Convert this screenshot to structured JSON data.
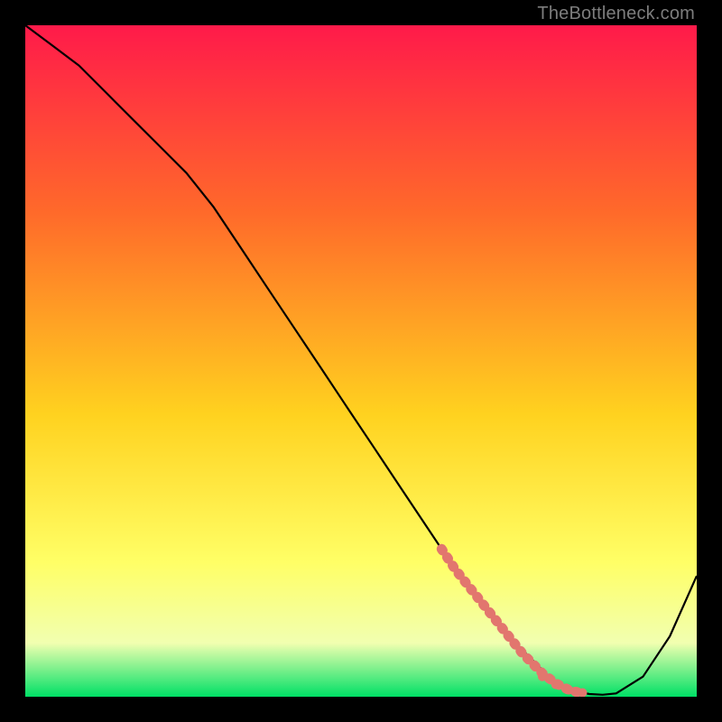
{
  "watermark": "TheBottleneck.com",
  "colors": {
    "black": "#000000",
    "curve": "#000000",
    "dash": "#e2766e",
    "grad_top": "#ff1a4a",
    "grad_mid1": "#ff6a2a",
    "grad_mid2": "#ffd21f",
    "grad_mid3": "#ffff66",
    "grad_mid4": "#f1ffb0",
    "grad_bottom": "#00e066"
  },
  "chart_data": {
    "type": "line",
    "title": "",
    "xlabel": "",
    "ylabel": "",
    "xlim": [
      0,
      100
    ],
    "ylim": [
      0,
      100
    ],
    "series": [
      {
        "name": "bottleneck-curve",
        "x": [
          0,
          4,
          8,
          12,
          16,
          20,
          24,
          28,
          32,
          36,
          40,
          44,
          48,
          52,
          56,
          60,
          64,
          68,
          72,
          76,
          78,
          80,
          82,
          84,
          86,
          88,
          92,
          96,
          100
        ],
        "y": [
          100,
          97,
          94,
          90,
          86,
          82,
          78,
          73,
          67,
          61,
          55,
          49,
          43,
          37,
          31,
          25,
          19,
          14,
          9,
          5,
          3,
          1.5,
          0.8,
          0.4,
          0.3,
          0.5,
          3,
          9,
          18
        ]
      }
    ],
    "highlight_segment": {
      "name": "dashed-optimal-zone",
      "x": [
        62,
        64,
        66,
        68,
        70,
        72,
        74,
        75.5,
        77,
        79,
        81,
        83
      ],
      "y": [
        22,
        19,
        16.5,
        14,
        11.5,
        9,
        6.5,
        5,
        3.5,
        2,
        1,
        0.5
      ]
    }
  }
}
